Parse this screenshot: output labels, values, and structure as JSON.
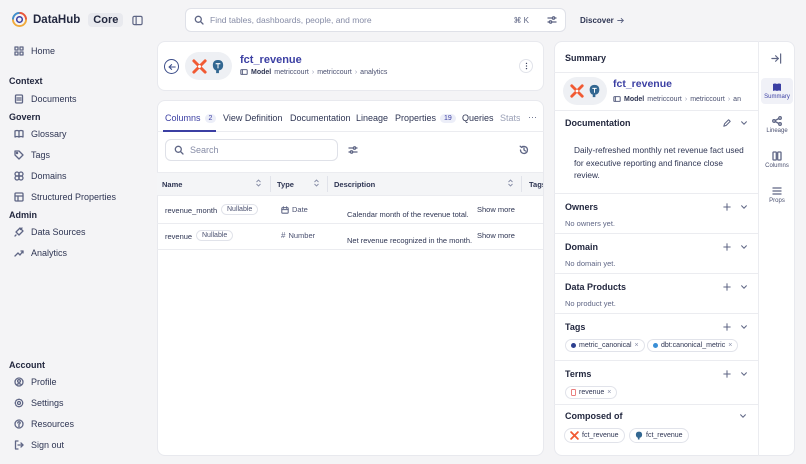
{
  "app": {
    "name": "DataHub",
    "badge": "Core"
  },
  "sidebar": {
    "home": "Home",
    "context_head": "Context",
    "documents": "Documents",
    "govern_head": "Govern",
    "glossary": "Glossary",
    "tags": "Tags",
    "domains": "Domains",
    "structured_properties": "Structured Properties",
    "admin_head": "Admin",
    "data_sources": "Data Sources",
    "analytics": "Analytics",
    "account_head": "Account",
    "profile": "Profile",
    "settings": "Settings",
    "resources": "Resources",
    "sign_out": "Sign out"
  },
  "search": {
    "placeholder": "Find tables, dashboards, people, and more",
    "shortcut": "⌘ K"
  },
  "discover": "Discover",
  "entity": {
    "title": "fct_revenue",
    "subtype": "Model",
    "crumbs": [
      "metriccourt",
      "metriccourt",
      "analytics"
    ]
  },
  "tabs": {
    "columns": "Columns",
    "columns_count": "2",
    "view_definition": "View Definition",
    "documentation": "Documentation",
    "lineage": "Lineage",
    "properties": "Properties",
    "properties_count": "19",
    "queries": "Queries",
    "stats": "Stats"
  },
  "column_search": {
    "placeholder": "Search"
  },
  "table": {
    "headers": {
      "name": "Name",
      "type": "Type",
      "description": "Description",
      "tags": "Tags"
    },
    "rows": [
      {
        "name": "revenue_month",
        "nullable": "Nullable",
        "type": "Date",
        "description": "Calendar month of the revenue total.",
        "more": "Show more"
      },
      {
        "name": "revenue",
        "nullable": "Nullable",
        "type": "Number",
        "description": "Net revenue recognized in the month.",
        "more": "Show more"
      }
    ]
  },
  "panel": {
    "title": "Summary",
    "entity_title": "fct_revenue",
    "subtype": "Model",
    "crumbs": [
      "metriccourt",
      "metriccourt",
      "an"
    ],
    "documentation": {
      "title": "Documentation",
      "text": "Daily-refreshed monthly net revenue fact used for executive reporting and finance close review."
    },
    "owners": {
      "title": "Owners",
      "empty": "No owners yet."
    },
    "domain": {
      "title": "Domain",
      "empty": "No domain yet."
    },
    "data_products": {
      "title": "Data Products",
      "empty": "No product yet."
    },
    "tags": {
      "title": "Tags",
      "items": [
        "metric_canonical",
        "dbt:canonical_metric"
      ]
    },
    "terms": {
      "title": "Terms",
      "items": [
        "revenue"
      ]
    },
    "composed_of": {
      "title": "Composed of",
      "items": [
        "fct_revenue",
        "fct_revenue"
      ]
    }
  },
  "side_tabs": {
    "summary": "Summary",
    "lineage": "Lineage",
    "columns": "Columns",
    "props": "Props"
  },
  "colors": {
    "accent": "#3b3fa3",
    "dbt": "#f15a33",
    "postgres": "#336791",
    "tag_blue_dark": "#2d3f8f",
    "tag_blue": "#3a8fd6",
    "term_red": "#e56a6a"
  }
}
